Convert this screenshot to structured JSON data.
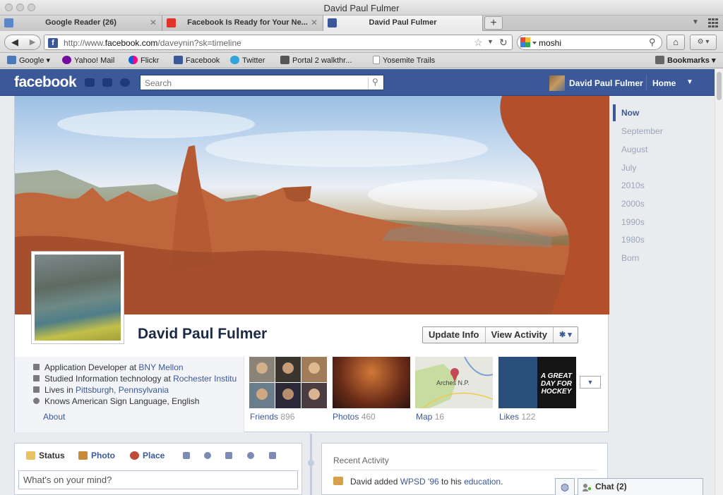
{
  "window": {
    "title": "David Paul Fulmer"
  },
  "tabs": [
    {
      "label": "Google Reader (26)",
      "icon": "google-reader-icon"
    },
    {
      "label": "Facebook Is Ready for Your Ne...",
      "icon": "verge-icon"
    },
    {
      "label": "David Paul Fulmer",
      "icon": "facebook-icon",
      "active": true
    }
  ],
  "nav": {
    "url_prefix": "http://www.",
    "url_domain": "facebook.com",
    "url_suffix": "/daveynin?sk=timeline",
    "search_value": "moshi"
  },
  "bookmarks": [
    {
      "label": "Google ▾",
      "icon": "folder-icon",
      "color": "#4a7ab8"
    },
    {
      "label": "Yahoo! Mail",
      "icon": "yahoo-icon",
      "color": "#720e9e"
    },
    {
      "label": "Flickr",
      "icon": "flickr-icon",
      "color": "#ff0084"
    },
    {
      "label": "Facebook",
      "icon": "facebook-icon",
      "color": "#3b5998"
    },
    {
      "label": "Twitter",
      "icon": "twitter-icon",
      "color": "#33a3dc"
    },
    {
      "label": "Portal 2 walkthr...",
      "icon": "gamefaqs-icon",
      "color": "#555555"
    },
    {
      "label": "Yosemite Trails",
      "icon": "page-icon",
      "color": "#ffffff"
    }
  ],
  "bookmarks_menu": "Bookmarks",
  "fb": {
    "logo": "facebook",
    "search_placeholder": "Search",
    "username": "David Paul Fulmer",
    "home": "Home",
    "brand_color": "#3b5998"
  },
  "profile": {
    "name": "David Paul Fulmer",
    "update_info": "Update Info",
    "view_activity": "View Activity",
    "settings": "✱ ▾"
  },
  "about": {
    "job_prefix": "Application Developer at ",
    "job_link": "BNY Mellon",
    "study_prefix": "Studied Information technology at ",
    "study_link": "Rochester Institu",
    "lives_prefix": "Lives in ",
    "lives_link": "Pittsburgh, Pennsylvania",
    "language": "Knows American Sign Language, English",
    "about_link": "About"
  },
  "tiles": [
    {
      "label": "Friends",
      "count": "896"
    },
    {
      "label": "Photos",
      "count": "460"
    },
    {
      "label": "Map",
      "count": "16"
    },
    {
      "label": "Likes",
      "count": "122"
    }
  ],
  "map_label": "Arches N.P.",
  "likes_text": "A GREAT DAY FOR HOCKEY",
  "timeline": [
    "Now",
    "September",
    "August",
    "July",
    "2010s",
    "2000s",
    "1990s",
    "1980s",
    "Born"
  ],
  "composer": {
    "status": "Status",
    "photo": "Photo",
    "place": "Place",
    "placeholder": "What's on your mind?"
  },
  "recent": {
    "title": "Recent Activity",
    "prefix": "David added ",
    "link1": "WPSD '96",
    "mid": " to his ",
    "link2": "education",
    "end": "."
  },
  "chat": {
    "label": "Chat (2)"
  }
}
